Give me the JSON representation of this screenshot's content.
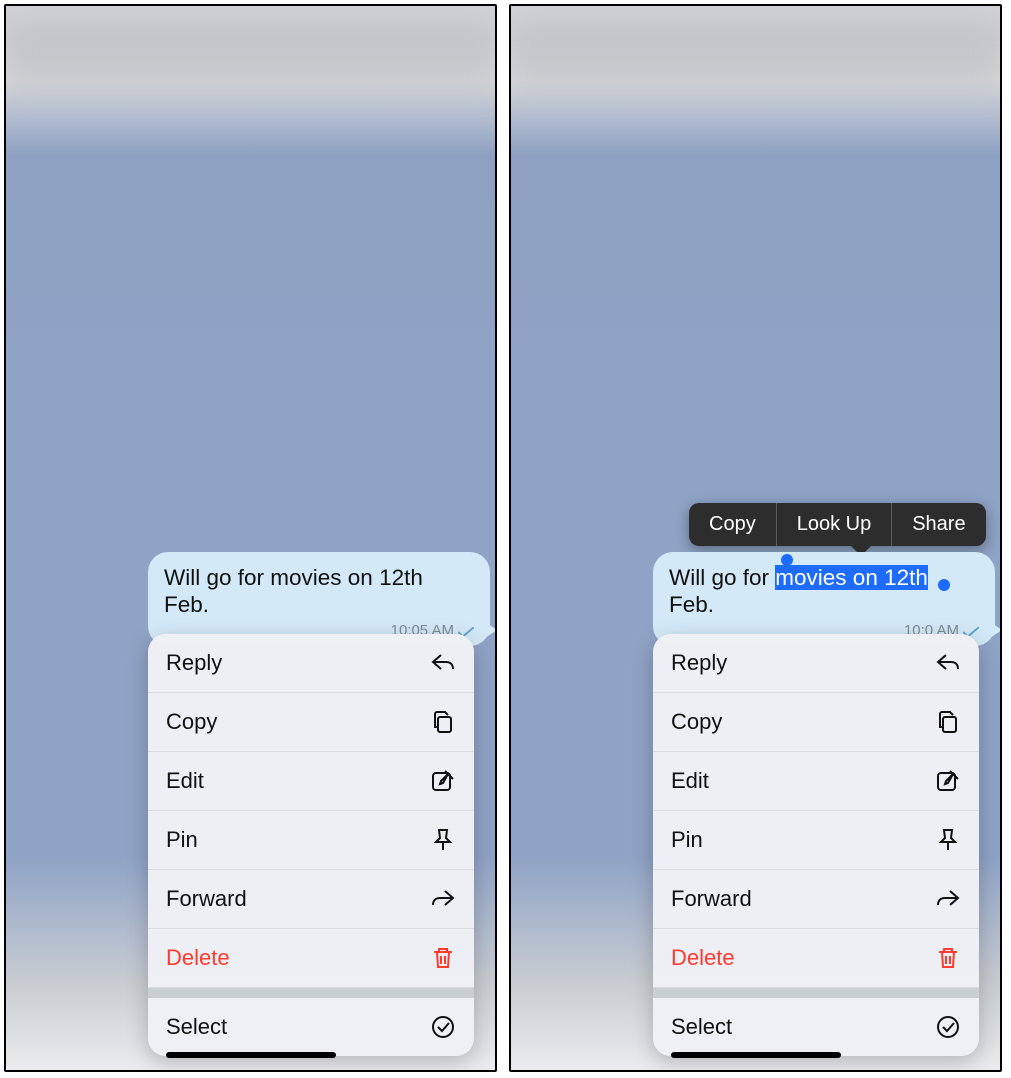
{
  "message": {
    "pre_text": "Will go for ",
    "highlight_text": "movies on 12th",
    "post_text": " Feb.",
    "full_text": "Will go for movies on 12th Feb.",
    "time_label": "10:05 AM",
    "time_label_right": "10:0    AM"
  },
  "context_menu": {
    "items": [
      {
        "label": "Reply",
        "icon": "reply"
      },
      {
        "label": "Copy",
        "icon": "copy"
      },
      {
        "label": "Edit",
        "icon": "edit"
      },
      {
        "label": "Pin",
        "icon": "pin"
      },
      {
        "label": "Forward",
        "icon": "forward"
      },
      {
        "label": "Delete",
        "icon": "trash",
        "destructive": true
      }
    ],
    "secondary": {
      "label": "Select",
      "icon": "select"
    }
  },
  "text_popover": {
    "items": [
      {
        "label": "Copy"
      },
      {
        "label": "Look Up"
      },
      {
        "label": "Share"
      }
    ]
  }
}
